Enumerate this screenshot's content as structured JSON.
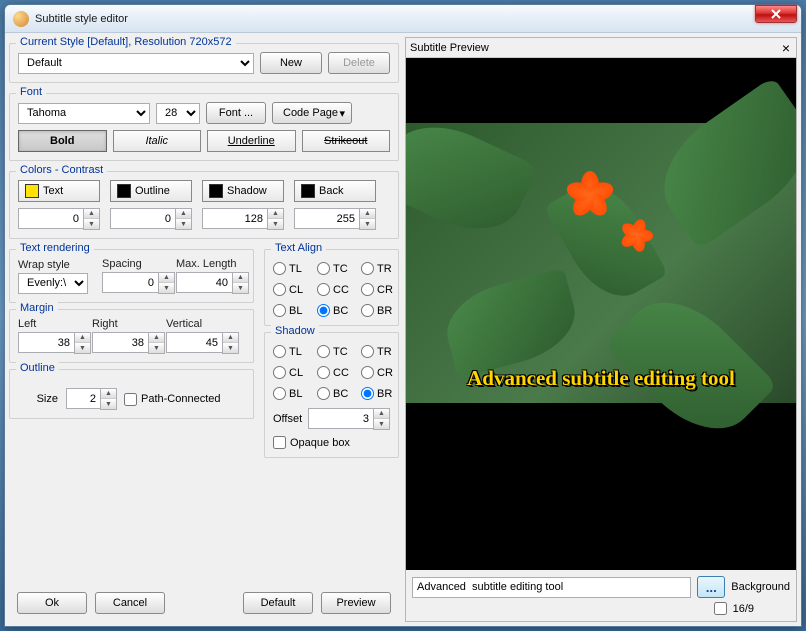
{
  "window": {
    "title": "Subtitle style editor"
  },
  "style_row": {
    "title": "Current Style [Default], Resolution 720x572",
    "select_value": "Default",
    "new_btn": "New",
    "delete_btn": "Delete"
  },
  "font_group": {
    "title": "Font",
    "font_value": "Tahoma",
    "size_value": "28",
    "font_btn": "Font ...",
    "codepage_btn": "Code Page",
    "bold": "Bold",
    "italic": "Italic",
    "underline": "Underline",
    "strikeout": "Strikeout"
  },
  "colors_group": {
    "title": "Colors - Contrast",
    "text_label": "Text",
    "text_color": "#ffe400",
    "text_val": "0",
    "outline_label": "Outline",
    "outline_color": "#000000",
    "outline_val": "0",
    "shadow_label": "Shadow",
    "shadow_color": "#000000",
    "shadow_val": "128",
    "back_label": "Back",
    "back_color": "#000000",
    "back_val": "255"
  },
  "text_rendering": {
    "title": "Text rendering",
    "wrap_label": "Wrap style",
    "wrap_value": "Evenly:\\N",
    "spacing_label": "Spacing",
    "spacing_value": "0",
    "maxlen_label": "Max. Length",
    "maxlen_value": "40"
  },
  "margin_group": {
    "title": "Margin",
    "left_label": "Left",
    "left_val": "38",
    "right_label": "Right",
    "right_val": "38",
    "vert_label": "Vertical",
    "vert_val": "45"
  },
  "outline_group": {
    "title": "Outline",
    "size_label": "Size",
    "size_val": "2",
    "path_label": "Path-Connected"
  },
  "text_align": {
    "title": "Text Align",
    "tl": "TL",
    "tc": "TC",
    "tr": "TR",
    "cl": "CL",
    "cc": "CC",
    "cr": "CR",
    "bl": "BL",
    "bc": "BC",
    "br": "BR",
    "selected": "BC"
  },
  "shadow_group": {
    "title": "Shadow",
    "tl": "TL",
    "tc": "TC",
    "tr": "TR",
    "cl": "CL",
    "cc": "CC",
    "cr": "CR",
    "bl": "BL",
    "bc": "BC",
    "br": "BR",
    "selected": "BR",
    "offset_label": "Offset",
    "offset_val": "3",
    "opaque_label": "Opaque box"
  },
  "buttons": {
    "ok": "Ok",
    "cancel": "Cancel",
    "default": "Default",
    "preview": "Preview"
  },
  "preview": {
    "title": "Subtitle Preview",
    "subtitle_text": "Advanced subtitle editing tool",
    "input_text": "Advanced  subtitle editing tool",
    "bg_label": "Background",
    "ratio_label": "16/9",
    "browse": "..."
  }
}
